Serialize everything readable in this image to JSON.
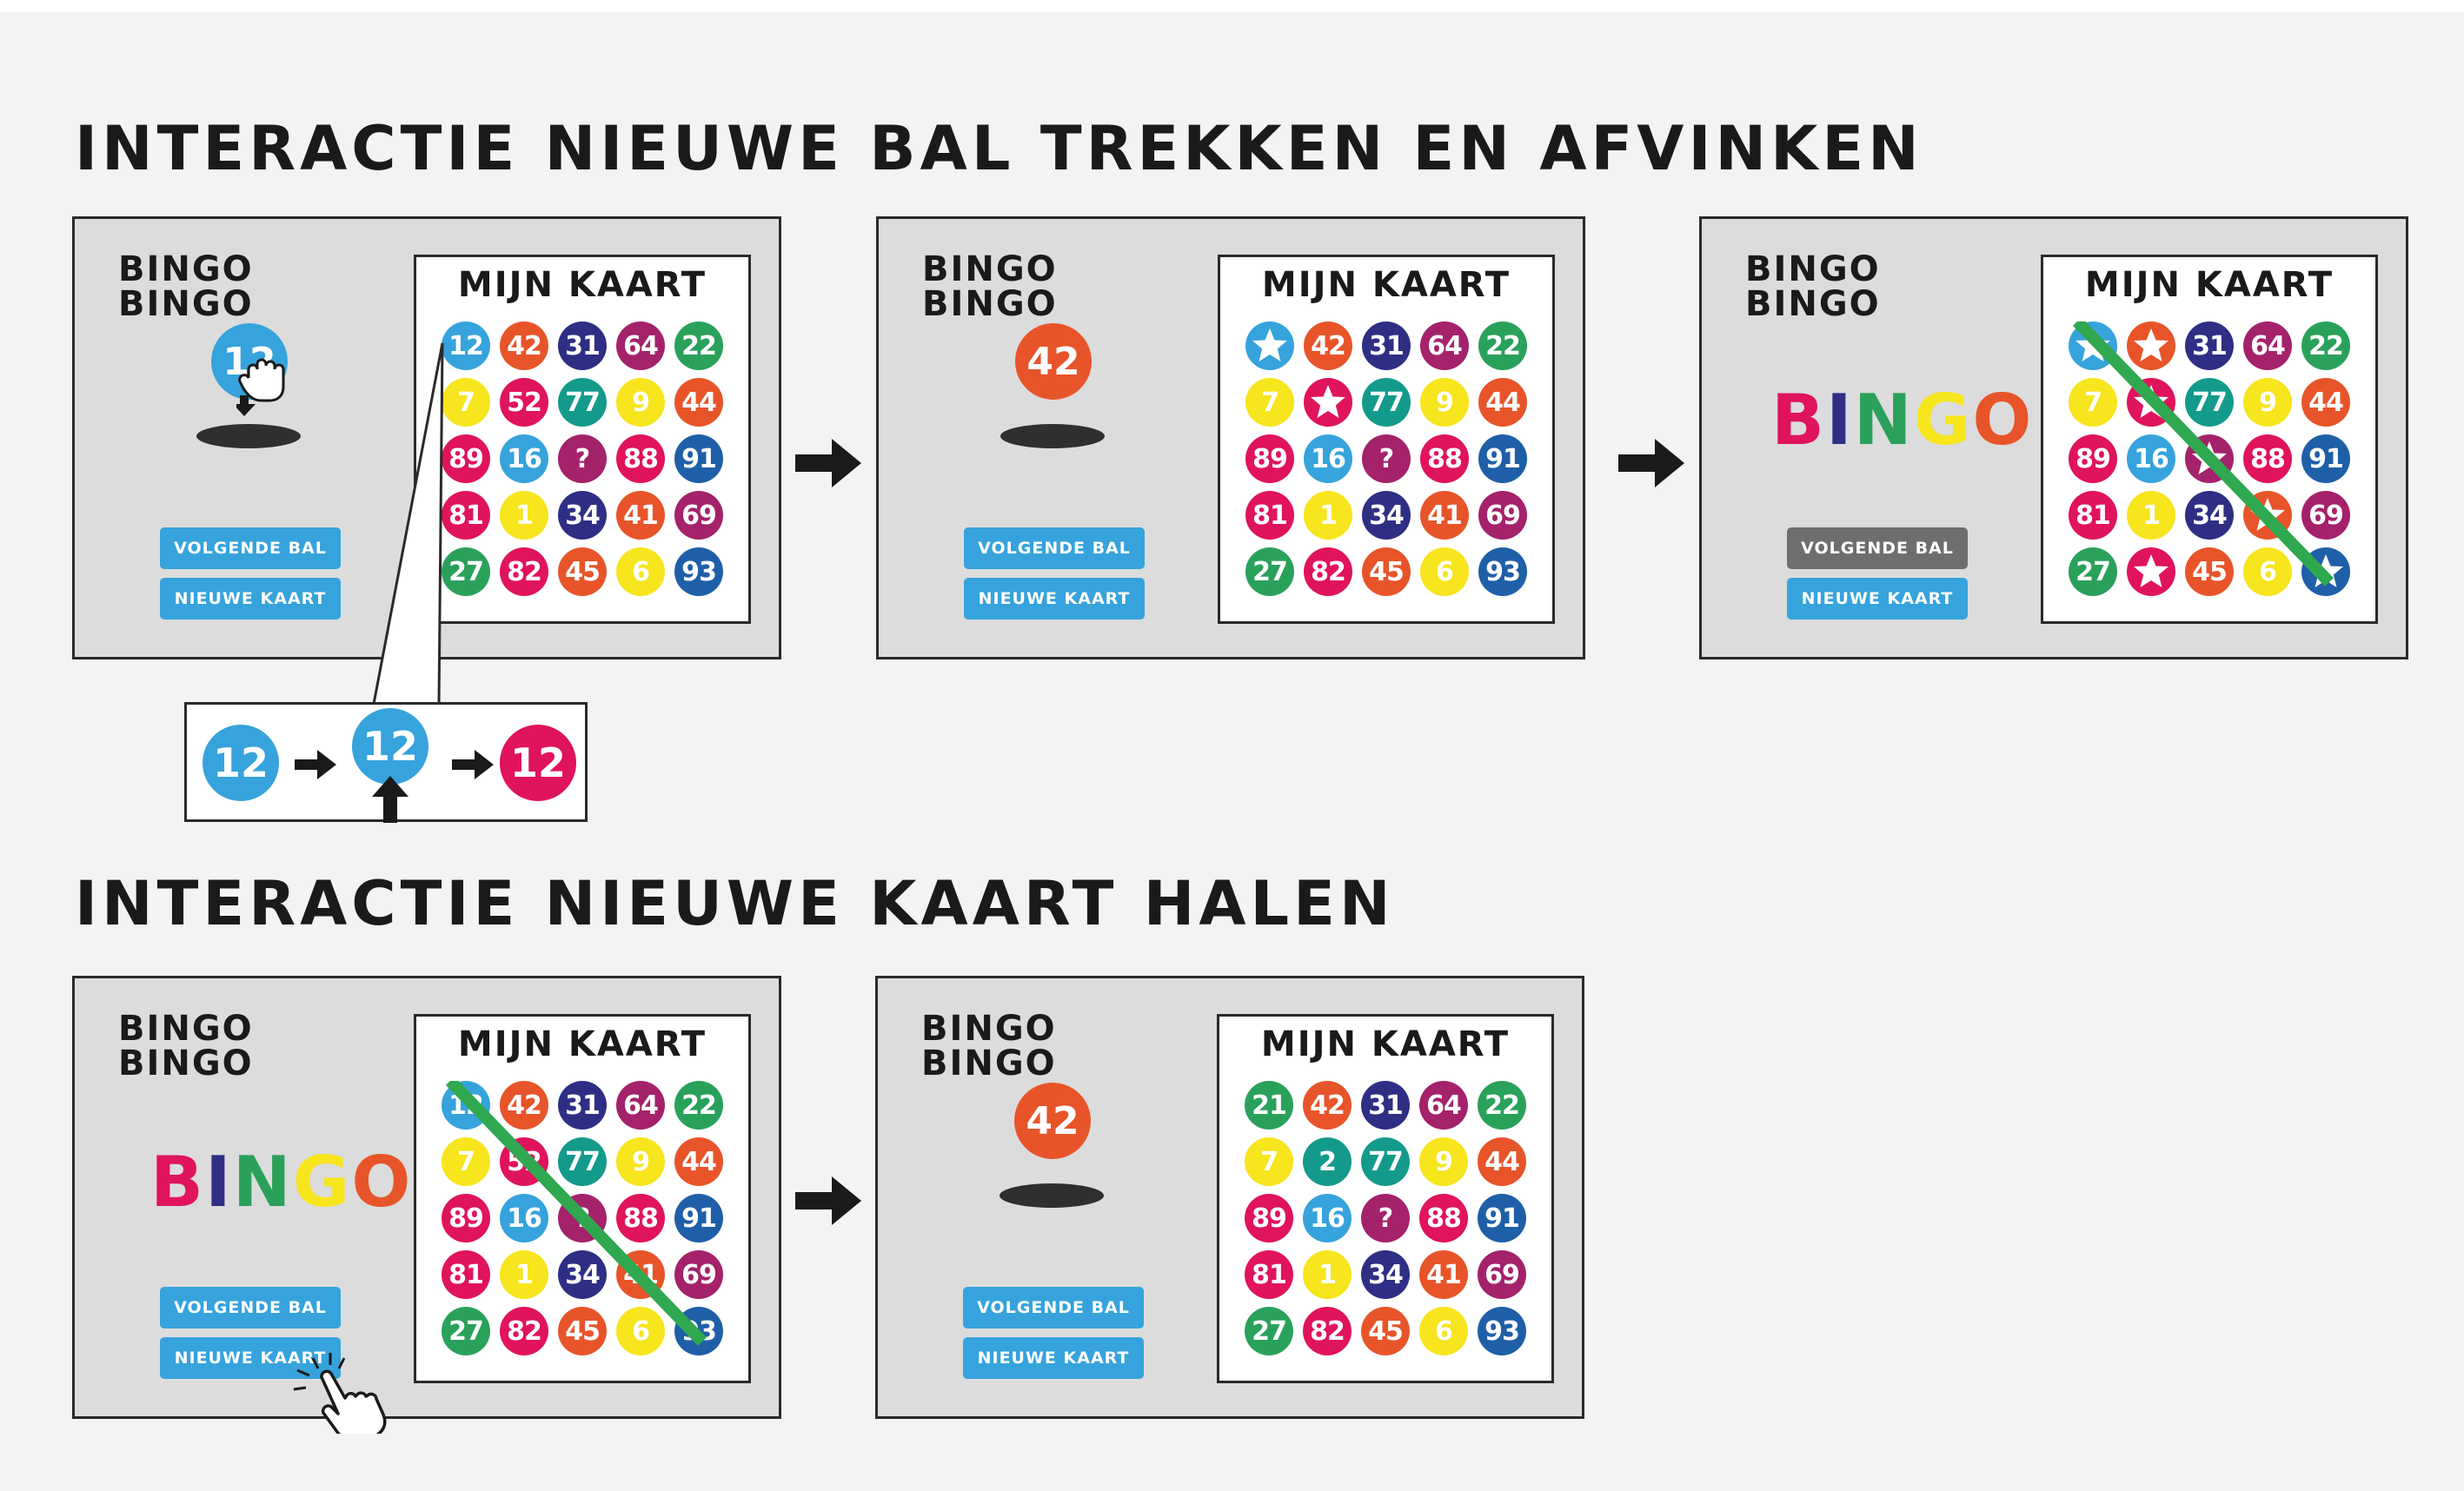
{
  "section1": {
    "title": "INTERACTIE NIEUWE BAL TREKKEN EN AFVINKEN"
  },
  "section2": {
    "title": "INTERACTIE NIEUWE KAART HALEN"
  },
  "colors": {
    "blue": "#36a3dc",
    "orange": "#e8542a",
    "navy": "#2e2f84",
    "plum": "#a4226a",
    "green": "#2aa15b",
    "yellow": "#f7e51e",
    "magenta": "#e0135d",
    "purple": "#7c2d8b",
    "darkblue": "#1f5fa8",
    "red": "#e4262d",
    "teal": "#139a8b",
    "button": "#36a3dc",
    "button_disabled": "#6e6e6e",
    "strike": "#2fa84f"
  },
  "bingo_letters": [
    {
      "ch": "B",
      "color": "#e0135d"
    },
    {
      "ch": "I",
      "color": "#2e2f84"
    },
    {
      "ch": "N",
      "color": "#2aa15b"
    },
    {
      "ch": "G",
      "color": "#f7e51e"
    },
    {
      "ch": "O",
      "color": "#e8542a"
    },
    {
      "ch": "!",
      "color": "#7c2d8b"
    }
  ],
  "zoom": {
    "values": [
      "12",
      "12",
      "12"
    ],
    "colors": [
      "#36a3dc",
      "#36a3dc",
      "#e0135d"
    ]
  },
  "panels": [
    {
      "name": "panel-1",
      "title": "BINGO BINGO",
      "card_title": "MIJN KAART",
      "drawn_ball": {
        "value": "12",
        "color": "#36a3dc"
      },
      "show_bingo": false,
      "buttons": {
        "next": "VOLGENDE BAL",
        "new": "NIEUWE KAART"
      },
      "next_disabled": false,
      "cells": [
        {
          "v": "12",
          "c": "#36a3dc"
        },
        {
          "v": "42",
          "c": "#e8542a"
        },
        {
          "v": "31",
          "c": "#2e2f84"
        },
        {
          "v": "64",
          "c": "#a4226a"
        },
        {
          "v": "22",
          "c": "#2aa15b"
        },
        {
          "v": "7",
          "c": "#f7e51e"
        },
        {
          "v": "52",
          "c": "#e0135d"
        },
        {
          "v": "77",
          "c": "#139a8b"
        },
        {
          "v": "9",
          "c": "#f7e51e"
        },
        {
          "v": "44",
          "c": "#e8542a"
        },
        {
          "v": "89",
          "c": "#e0135d"
        },
        {
          "v": "16",
          "c": "#36a3dc"
        },
        {
          "v": "?",
          "c": "#a4226a"
        },
        {
          "v": "88",
          "c": "#e0135d"
        },
        {
          "v": "91",
          "c": "#1f5fa8"
        },
        {
          "v": "81",
          "c": "#e0135d"
        },
        {
          "v": "1",
          "c": "#f7e51e"
        },
        {
          "v": "34",
          "c": "#2e2f84"
        },
        {
          "v": "41",
          "c": "#e8542a"
        },
        {
          "v": "69",
          "c": "#a4226a"
        },
        {
          "v": "27",
          "c": "#2aa15b"
        },
        {
          "v": "82",
          "c": "#e0135d"
        },
        {
          "v": "45",
          "c": "#e8542a"
        },
        {
          "v": "6",
          "c": "#f7e51e"
        },
        {
          "v": "93",
          "c": "#1f5fa8"
        }
      ]
    },
    {
      "name": "panel-2",
      "title": "BINGO BINGO",
      "card_title": "MIJN KAART",
      "drawn_ball": {
        "value": "42",
        "color": "#e8542a"
      },
      "show_bingo": false,
      "buttons": {
        "next": "VOLGENDE BAL",
        "new": "NIEUWE KAART"
      },
      "next_disabled": false,
      "cells": [
        {
          "v": "★",
          "c": "#36a3dc",
          "star": true
        },
        {
          "v": "42",
          "c": "#e8542a"
        },
        {
          "v": "31",
          "c": "#2e2f84"
        },
        {
          "v": "64",
          "c": "#a4226a"
        },
        {
          "v": "22",
          "c": "#2aa15b"
        },
        {
          "v": "7",
          "c": "#f7e51e"
        },
        {
          "v": "★",
          "c": "#e0135d",
          "star": true
        },
        {
          "v": "77",
          "c": "#139a8b"
        },
        {
          "v": "9",
          "c": "#f7e51e"
        },
        {
          "v": "44",
          "c": "#e8542a"
        },
        {
          "v": "89",
          "c": "#e0135d"
        },
        {
          "v": "16",
          "c": "#36a3dc"
        },
        {
          "v": "?",
          "c": "#a4226a"
        },
        {
          "v": "88",
          "c": "#e0135d"
        },
        {
          "v": "91",
          "c": "#1f5fa8"
        },
        {
          "v": "81",
          "c": "#e0135d"
        },
        {
          "v": "1",
          "c": "#f7e51e"
        },
        {
          "v": "34",
          "c": "#2e2f84"
        },
        {
          "v": "41",
          "c": "#e8542a"
        },
        {
          "v": "69",
          "c": "#a4226a"
        },
        {
          "v": "27",
          "c": "#2aa15b"
        },
        {
          "v": "82",
          "c": "#e0135d"
        },
        {
          "v": "45",
          "c": "#e8542a"
        },
        {
          "v": "6",
          "c": "#f7e51e"
        },
        {
          "v": "93",
          "c": "#1f5fa8"
        }
      ]
    },
    {
      "name": "panel-3",
      "title": "BINGO BINGO",
      "card_title": "MIJN KAART",
      "drawn_ball": null,
      "show_bingo": true,
      "buttons": {
        "next": "VOLGENDE BAL",
        "new": "NIEUWE KAART"
      },
      "next_disabled": true,
      "cells": [
        {
          "v": "★",
          "c": "#36a3dc",
          "star": true
        },
        {
          "v": "★",
          "c": "#e8542a",
          "star": true
        },
        {
          "v": "31",
          "c": "#2e2f84"
        },
        {
          "v": "64",
          "c": "#a4226a"
        },
        {
          "v": "22",
          "c": "#2aa15b"
        },
        {
          "v": "7",
          "c": "#f7e51e"
        },
        {
          "v": "★",
          "c": "#e0135d",
          "star": true
        },
        {
          "v": "77",
          "c": "#139a8b"
        },
        {
          "v": "9",
          "c": "#f7e51e"
        },
        {
          "v": "44",
          "c": "#e8542a"
        },
        {
          "v": "89",
          "c": "#e0135d"
        },
        {
          "v": "16",
          "c": "#36a3dc"
        },
        {
          "v": "★",
          "c": "#a4226a",
          "star": true
        },
        {
          "v": "88",
          "c": "#e0135d"
        },
        {
          "v": "91",
          "c": "#1f5fa8"
        },
        {
          "v": "81",
          "c": "#e0135d"
        },
        {
          "v": "1",
          "c": "#f7e51e"
        },
        {
          "v": "34",
          "c": "#2e2f84"
        },
        {
          "v": "★",
          "c": "#e8542a",
          "star": true
        },
        {
          "v": "69",
          "c": "#a4226a"
        },
        {
          "v": "27",
          "c": "#2aa15b"
        },
        {
          "v": "★",
          "c": "#e0135d",
          "star": true
        },
        {
          "v": "45",
          "c": "#e8542a"
        },
        {
          "v": "6",
          "c": "#f7e51e"
        },
        {
          "v": "★",
          "c": "#1f5fa8",
          "star": true
        }
      ]
    },
    {
      "name": "panel-4",
      "title": "BINGO BINGO",
      "card_title": "MIJN KAART",
      "drawn_ball": null,
      "show_bingo": true,
      "buttons": {
        "next": "VOLGENDE BAL",
        "new": "NIEUWE KAART"
      },
      "next_disabled": false,
      "cells": [
        {
          "v": "12",
          "c": "#36a3dc"
        },
        {
          "v": "42",
          "c": "#e8542a"
        },
        {
          "v": "31",
          "c": "#2e2f84"
        },
        {
          "v": "64",
          "c": "#a4226a"
        },
        {
          "v": "22",
          "c": "#2aa15b"
        },
        {
          "v": "7",
          "c": "#f7e51e"
        },
        {
          "v": "52",
          "c": "#e0135d"
        },
        {
          "v": "77",
          "c": "#139a8b"
        },
        {
          "v": "9",
          "c": "#f7e51e"
        },
        {
          "v": "44",
          "c": "#e8542a"
        },
        {
          "v": "89",
          "c": "#e0135d"
        },
        {
          "v": "16",
          "c": "#36a3dc"
        },
        {
          "v": "?",
          "c": "#a4226a"
        },
        {
          "v": "88",
          "c": "#e0135d"
        },
        {
          "v": "91",
          "c": "#1f5fa8"
        },
        {
          "v": "81",
          "c": "#e0135d"
        },
        {
          "v": "1",
          "c": "#f7e51e"
        },
        {
          "v": "34",
          "c": "#2e2f84"
        },
        {
          "v": "41",
          "c": "#e8542a"
        },
        {
          "v": "69",
          "c": "#a4226a"
        },
        {
          "v": "27",
          "c": "#2aa15b"
        },
        {
          "v": "82",
          "c": "#e0135d"
        },
        {
          "v": "45",
          "c": "#e8542a"
        },
        {
          "v": "6",
          "c": "#f7e51e"
        },
        {
          "v": "93",
          "c": "#1f5fa8"
        }
      ]
    },
    {
      "name": "panel-5",
      "title": "BINGO BINGO",
      "card_title": "MIJN KAART",
      "drawn_ball": {
        "value": "42",
        "color": "#e8542a"
      },
      "show_bingo": false,
      "buttons": {
        "next": "VOLGENDE BAL",
        "new": "NIEUWE KAART"
      },
      "next_disabled": false,
      "cells": [
        {
          "v": "21",
          "c": "#2aa15b"
        },
        {
          "v": "42",
          "c": "#e8542a"
        },
        {
          "v": "31",
          "c": "#2e2f84"
        },
        {
          "v": "64",
          "c": "#a4226a"
        },
        {
          "v": "22",
          "c": "#2aa15b"
        },
        {
          "v": "7",
          "c": "#f7e51e"
        },
        {
          "v": "2",
          "c": "#139a8b"
        },
        {
          "v": "77",
          "c": "#139a8b"
        },
        {
          "v": "9",
          "c": "#f7e51e"
        },
        {
          "v": "44",
          "c": "#e8542a"
        },
        {
          "v": "89",
          "c": "#e0135d"
        },
        {
          "v": "16",
          "c": "#36a3dc"
        },
        {
          "v": "?",
          "c": "#a4226a"
        },
        {
          "v": "88",
          "c": "#e0135d"
        },
        {
          "v": "91",
          "c": "#1f5fa8"
        },
        {
          "v": "81",
          "c": "#e0135d"
        },
        {
          "v": "1",
          "c": "#f7e51e"
        },
        {
          "v": "34",
          "c": "#2e2f84"
        },
        {
          "v": "41",
          "c": "#e8542a"
        },
        {
          "v": "69",
          "c": "#a4226a"
        },
        {
          "v": "27",
          "c": "#2aa15b"
        },
        {
          "v": "82",
          "c": "#e0135d"
        },
        {
          "v": "45",
          "c": "#e8542a"
        },
        {
          "v": "6",
          "c": "#f7e51e"
        },
        {
          "v": "93",
          "c": "#1f5fa8"
        }
      ]
    }
  ]
}
